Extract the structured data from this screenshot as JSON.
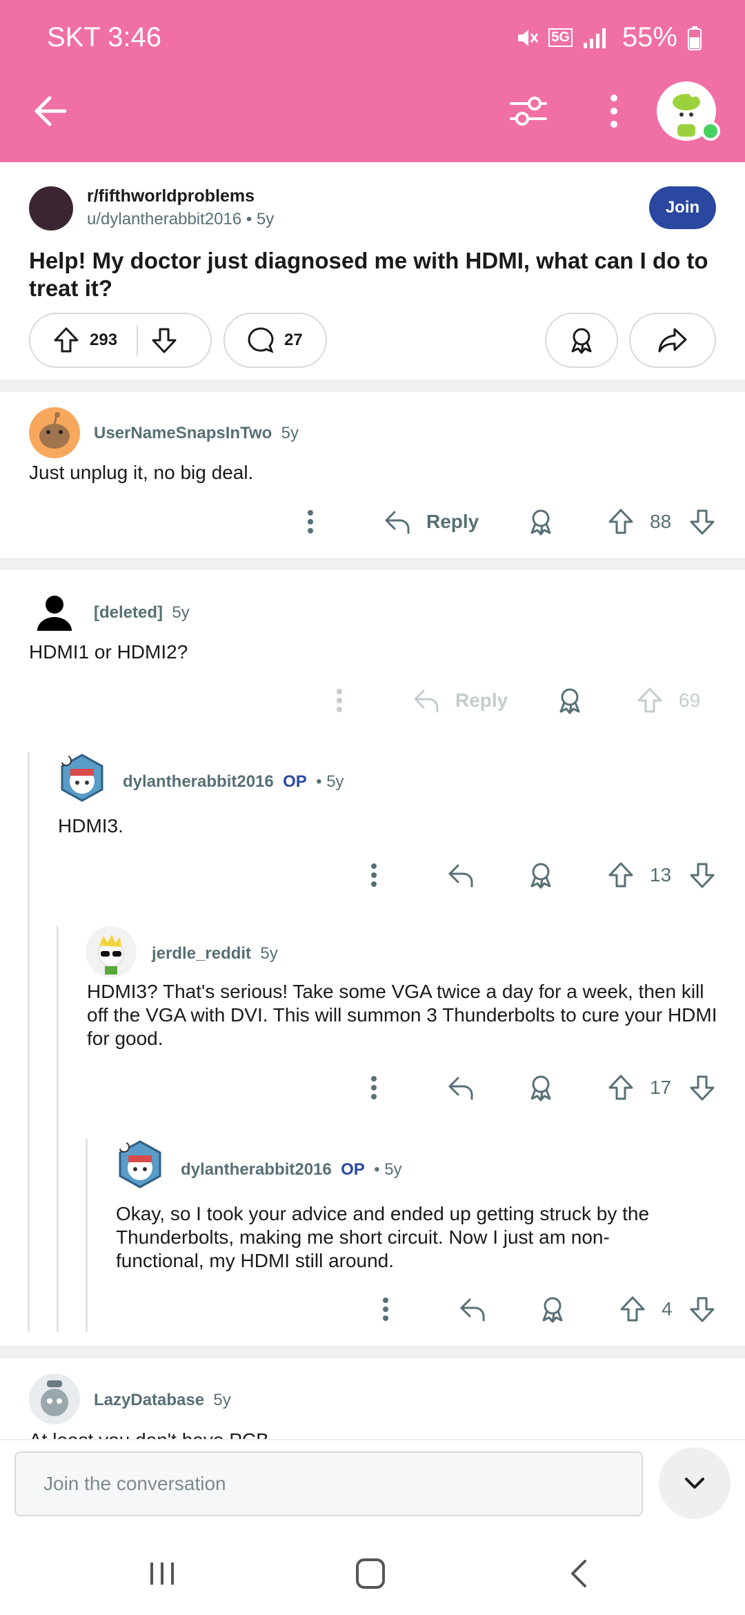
{
  "status_bar": {
    "carrier_time": "SKT 3:46",
    "network": "5G",
    "battery": "55%"
  },
  "app_bar": {
    "icons": [
      "back-arrow-icon",
      "filter-icon",
      "more-vertical-icon",
      "user-avatar"
    ]
  },
  "post": {
    "subreddit": "r/fifthworldproblems",
    "author_meta": "u/dylantherabbit2016 • 5y",
    "join_label": "Join",
    "title": "Help! My doctor just diagnosed me with HDMI, what can I do to treat it?",
    "upvotes": "293",
    "comments": "27"
  },
  "comments": [
    {
      "user": "UserNameSnapsInTwo",
      "age": "5y",
      "body": "Just unplug it, no big deal.",
      "reply_label": "Reply",
      "votes": "88"
    },
    {
      "user": "[deleted]",
      "age": "5y",
      "body": "HDMI1 or HDMI2?",
      "reply_label": "Reply",
      "votes": "69"
    },
    {
      "user": "dylantherabbit2016",
      "op": "OP",
      "age": "• 5y",
      "body": "HDMI3.",
      "votes": "13"
    },
    {
      "user": "jerdle_reddit",
      "age": "5y",
      "body": "HDMI3? That's serious! Take some VGA twice a day for a week, then kill off the VGA with DVI. This will summon 3 Thunderbolts to cure your HDMI for good.",
      "votes": "17"
    },
    {
      "user": "dylantherabbit2016",
      "op": "OP",
      "age": "• 5y",
      "body": "Okay, so I took your advice and ended up getting struck by the Thunderbolts, making me short circuit. Now I just am non-functional, my HDMI still around.",
      "votes": "4"
    },
    {
      "user": "LazyDatabase",
      "age": "5y",
      "body": "At least you don't have PCB"
    }
  ],
  "composer": {
    "placeholder": "Join the conversation"
  },
  "colors": {
    "header": "#f06fa5",
    "join": "#2a48a0",
    "op": "#2a48a0"
  }
}
